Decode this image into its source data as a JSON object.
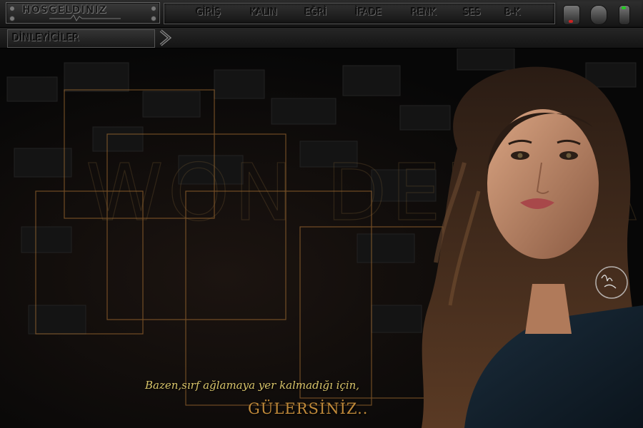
{
  "header": {
    "logo_text": "HOSGELDINIZ",
    "nav": [
      {
        "label": "GİRİŞ"
      },
      {
        "label": "KALIN"
      },
      {
        "label": "EĞRİ"
      },
      {
        "label": "İFADE"
      },
      {
        "label": "RENK"
      },
      {
        "label": "SES"
      },
      {
        "label": "B-K"
      }
    ]
  },
  "listeners": {
    "label": "DİNLEYİCİLER"
  },
  "background": {
    "letters": "WON DER LAND"
  },
  "quote": {
    "line1": "Bazen,sırf ağlamaya yer kalmadığı için,",
    "line2": "GÜLERSİNİZ.."
  },
  "colors": {
    "accent_orange": "#c0803a",
    "quote_gold": "#d8c46a",
    "panel_dark": "#1a1a1a"
  }
}
